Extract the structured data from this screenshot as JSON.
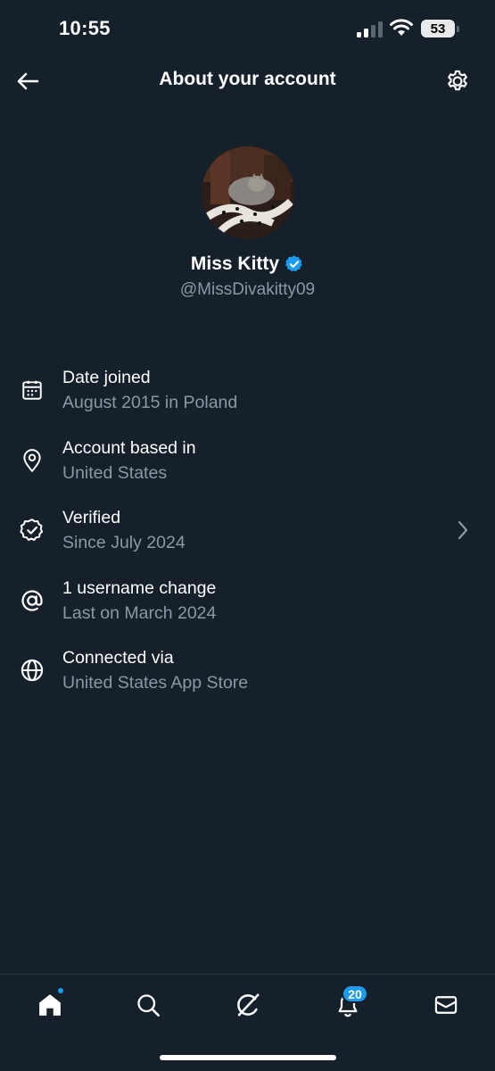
{
  "status_bar": {
    "time": "10:55",
    "battery": "53"
  },
  "header": {
    "title": "About your account",
    "back_icon": "arrow-left-icon",
    "settings_icon": "gear-icon"
  },
  "profile": {
    "display_name": "Miss Kitty",
    "handle": "@MissDivakitty09",
    "verified_badge_color": "#1d9bf0"
  },
  "info_rows": [
    {
      "icon": "calendar-icon",
      "title": "Date joined",
      "subtitle": "August 2015 in Poland"
    },
    {
      "icon": "location-pin-icon",
      "title": "Account based in",
      "subtitle": "United States"
    },
    {
      "icon": "verified-badge-icon",
      "title": "Verified",
      "subtitle": "Since July 2024",
      "chevron": true
    },
    {
      "icon": "at-sign-icon",
      "title": "1 username change",
      "subtitle": "Last on March 2024"
    },
    {
      "icon": "globe-icon",
      "title": "Connected via",
      "subtitle": "United States App Store"
    }
  ],
  "bottom_nav": {
    "items": [
      "home-icon",
      "search-icon",
      "grok-icon",
      "bell-icon",
      "mail-icon"
    ],
    "notifications_count": "20"
  },
  "colors": {
    "background": "#15202b",
    "accent": "#1d9bf0",
    "secondary_text": "#8b98a5"
  }
}
